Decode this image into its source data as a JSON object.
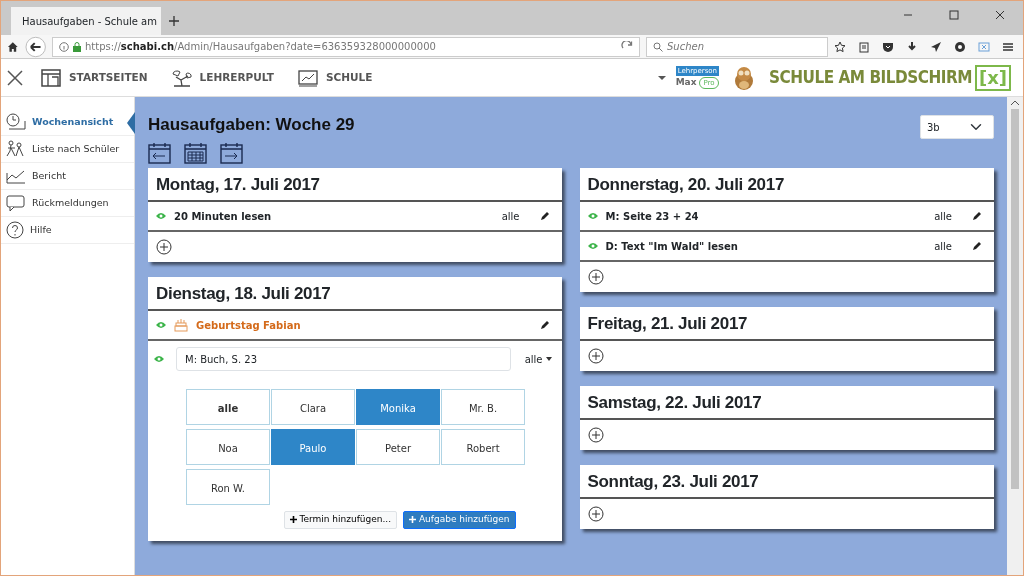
{
  "browser": {
    "tab_title": "Hausaufgaben - Schule am",
    "url_prefix": "https://",
    "url_host": "schabi.ch",
    "url_path": "/Admin/Hausaufgaben?date=636359328000000000",
    "search_placeholder": "Suchen"
  },
  "app_nav": {
    "items": [
      {
        "label": "STARTSEITEN"
      },
      {
        "label": "LEHRERPULT"
      },
      {
        "label": "SCHULE"
      }
    ],
    "role": "Lehrperson",
    "user": "Max",
    "plan": "Pro",
    "logo": "SCHULE AM BILDSCHIRM",
    "logo_mark": "[x]"
  },
  "sidebar": {
    "items": [
      {
        "label": "Wochenansicht",
        "selected": true
      },
      {
        "label": "Liste nach Schüler",
        "selected": false
      },
      {
        "label": "Bericht",
        "selected": false
      },
      {
        "label": "Rückmeldungen",
        "selected": false
      },
      {
        "label": "Hilfe",
        "selected": false
      }
    ]
  },
  "page": {
    "title": "Hausaufgaben: Woche 29",
    "class_select": "3b"
  },
  "days_left": [
    {
      "title": "Montag, 17. Juli 2017",
      "add_button": true,
      "entries": [
        {
          "kind": "task",
          "text": "20 Minuten lesen",
          "audience": "alle"
        }
      ]
    },
    {
      "title": "Dienstag, 18. Juli 2017",
      "entries": [
        {
          "kind": "event",
          "text": "Geburtstag Fabian"
        }
      ],
      "editor": {
        "value": "M: Buch, S. 23",
        "audience": "alle",
        "students": [
          {
            "name": "alle",
            "kind": "all",
            "selected": false
          },
          {
            "name": "Clara",
            "kind": "student",
            "selected": false
          },
          {
            "name": "Monika",
            "kind": "student",
            "selected": true
          },
          {
            "name": "Mr. B.",
            "kind": "student",
            "selected": false
          },
          {
            "name": "Noa",
            "kind": "student",
            "selected": false
          },
          {
            "name": "Paulo",
            "kind": "student",
            "selected": true
          },
          {
            "name": "Peter",
            "kind": "student",
            "selected": false
          },
          {
            "name": "Robert",
            "kind": "student",
            "selected": false
          },
          {
            "name": "Ron W.",
            "kind": "student",
            "selected": false
          }
        ],
        "buttons": [
          {
            "label": "Termin hinzufügen...",
            "kind": "secondary"
          },
          {
            "label": "Aufgabe hinzufügen",
            "kind": "primary"
          }
        ]
      }
    }
  ],
  "days_right": [
    {
      "title": "Donnerstag, 20. Juli 2017",
      "add_button": true,
      "entries": [
        {
          "kind": "task",
          "text": "M: Seite 23 + 24",
          "audience": "alle"
        },
        {
          "kind": "task",
          "text": "D: Text \"Im Wald\" lesen",
          "audience": "alle"
        }
      ]
    },
    {
      "title": "Freitag, 21. Juli 2017",
      "add_button": true
    },
    {
      "title": "Samstag, 22. Juli 2017",
      "add_button": true
    },
    {
      "title": "Sonntag, 23. Juli 2017",
      "add_button": true
    }
  ]
}
